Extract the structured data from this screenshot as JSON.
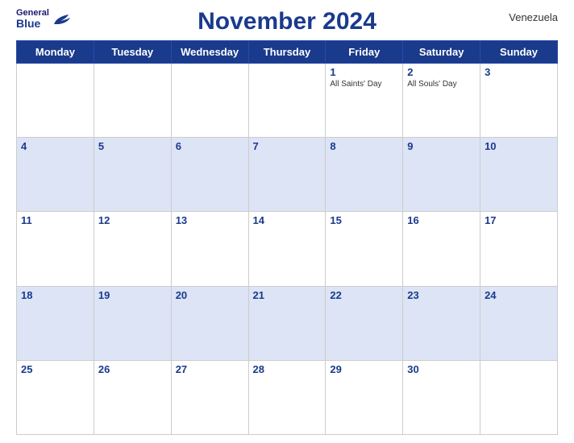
{
  "header": {
    "title": "November 2024",
    "country": "Venezuela",
    "logo_general": "General",
    "logo_blue": "Blue"
  },
  "weekdays": [
    "Monday",
    "Tuesday",
    "Wednesday",
    "Thursday",
    "Friday",
    "Saturday",
    "Sunday"
  ],
  "weeks": [
    [
      {
        "day": "",
        "holiday": ""
      },
      {
        "day": "",
        "holiday": ""
      },
      {
        "day": "",
        "holiday": ""
      },
      {
        "day": "",
        "holiday": ""
      },
      {
        "day": "1",
        "holiday": "All Saints' Day"
      },
      {
        "day": "2",
        "holiday": "All Souls' Day"
      },
      {
        "day": "3",
        "holiday": ""
      }
    ],
    [
      {
        "day": "4",
        "holiday": ""
      },
      {
        "day": "5",
        "holiday": ""
      },
      {
        "day": "6",
        "holiday": ""
      },
      {
        "day": "7",
        "holiday": ""
      },
      {
        "day": "8",
        "holiday": ""
      },
      {
        "day": "9",
        "holiday": ""
      },
      {
        "day": "10",
        "holiday": ""
      }
    ],
    [
      {
        "day": "11",
        "holiday": ""
      },
      {
        "day": "12",
        "holiday": ""
      },
      {
        "day": "13",
        "holiday": ""
      },
      {
        "day": "14",
        "holiday": ""
      },
      {
        "day": "15",
        "holiday": ""
      },
      {
        "day": "16",
        "holiday": ""
      },
      {
        "day": "17",
        "holiday": ""
      }
    ],
    [
      {
        "day": "18",
        "holiday": ""
      },
      {
        "day": "19",
        "holiday": ""
      },
      {
        "day": "20",
        "holiday": ""
      },
      {
        "day": "21",
        "holiday": ""
      },
      {
        "day": "22",
        "holiday": ""
      },
      {
        "day": "23",
        "holiday": ""
      },
      {
        "day": "24",
        "holiday": ""
      }
    ],
    [
      {
        "day": "25",
        "holiday": ""
      },
      {
        "day": "26",
        "holiday": ""
      },
      {
        "day": "27",
        "holiday": ""
      },
      {
        "day": "28",
        "holiday": ""
      },
      {
        "day": "29",
        "holiday": ""
      },
      {
        "day": "30",
        "holiday": ""
      },
      {
        "day": "",
        "holiday": ""
      }
    ]
  ]
}
